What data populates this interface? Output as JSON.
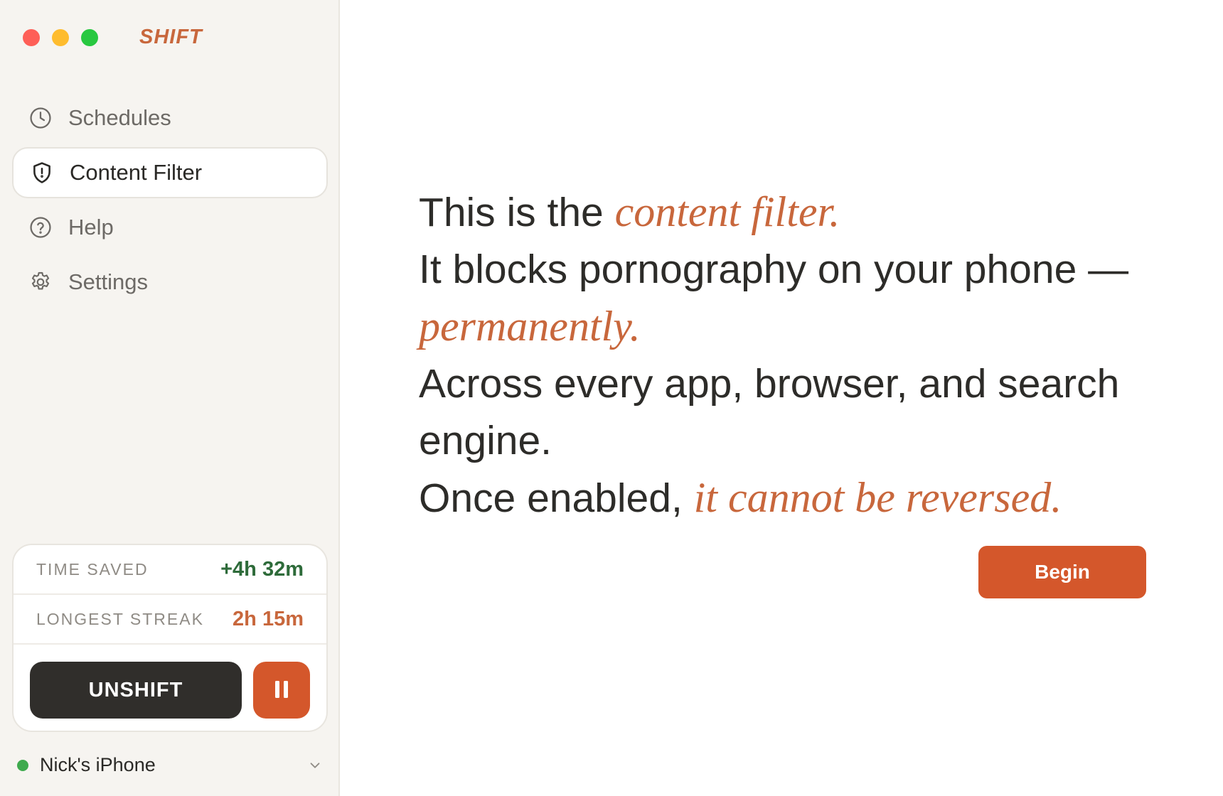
{
  "app": {
    "brand": "SHIFT"
  },
  "sidebar": {
    "items": [
      {
        "label": "Schedules",
        "icon": "clock-icon",
        "active": false
      },
      {
        "label": "Content Filter",
        "icon": "shield-alert-icon",
        "active": true
      },
      {
        "label": "Help",
        "icon": "help-circle-icon",
        "active": false
      },
      {
        "label": "Settings",
        "icon": "gear-icon",
        "active": false
      }
    ]
  },
  "stats": {
    "time_saved_label": "TIME SAVED",
    "time_saved_value": "+4h 32m",
    "longest_streak_label": "LONGEST STREAK",
    "longest_streak_value": "2h 15m",
    "unshift_label": "UNSHIFT",
    "pause_icon": "pause-icon"
  },
  "device": {
    "name": "Nick's iPhone",
    "status": "connected",
    "status_color": "#3faa4e"
  },
  "main": {
    "line1_plain": "This is the ",
    "line1_accent": "content filter.",
    "line2_plain": "It blocks pornography on your phone —",
    "line2_accent": "permanently.",
    "line3_plain": "Across every app, browser, and search engine.",
    "line4_plain": "Once enabled, ",
    "line4_accent": "it cannot be reversed.",
    "begin_label": "Begin"
  },
  "colors": {
    "accent": "#c8673c",
    "button_orange": "#d4572b",
    "dark_button": "#302e2b",
    "sidebar_bg": "#f6f4f0",
    "time_saved_green": "#2e6b3a"
  }
}
